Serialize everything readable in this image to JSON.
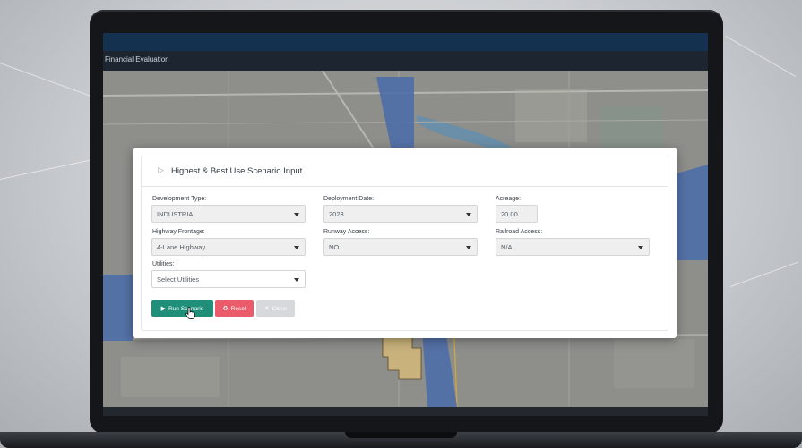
{
  "app": {
    "nav_title": "Financial Evaluation"
  },
  "modal": {
    "title": "Highest & Best Use Scenario Input",
    "fields": {
      "development_type": {
        "label": "Development Type:",
        "value": "INDUSTRIAL"
      },
      "deployment_date": {
        "label": "Deployment Date:",
        "value": "2023"
      },
      "acreage": {
        "label": "Acreage:",
        "value": "20.00"
      },
      "highway_frontage": {
        "label": "Highway Frontage:",
        "value": "4-Lane Highway"
      },
      "runway_access": {
        "label": "Runway Access:",
        "value": "NO"
      },
      "railroad_access": {
        "label": "Railroad Access:",
        "value": "N/A"
      },
      "utilities": {
        "label": "Utilities:",
        "value": "Select Utilities"
      }
    },
    "buttons": {
      "run": "Run Scenario",
      "reset": "Reset",
      "close": "Close"
    }
  },
  "icons": {
    "collapse": "triangle-right-icon",
    "run": "play-icon",
    "reset": "recycle-icon",
    "close": "close-icon",
    "dropdown": "chevron-down-icon",
    "cursor": "hand-pointer-icon"
  },
  "colors": {
    "run_button": "#1f8f7a",
    "reset_button": "#ea5b6b",
    "close_button": "#d6d8dc",
    "top_bar": "#143150",
    "map_polygon": "#4f6fa8"
  }
}
